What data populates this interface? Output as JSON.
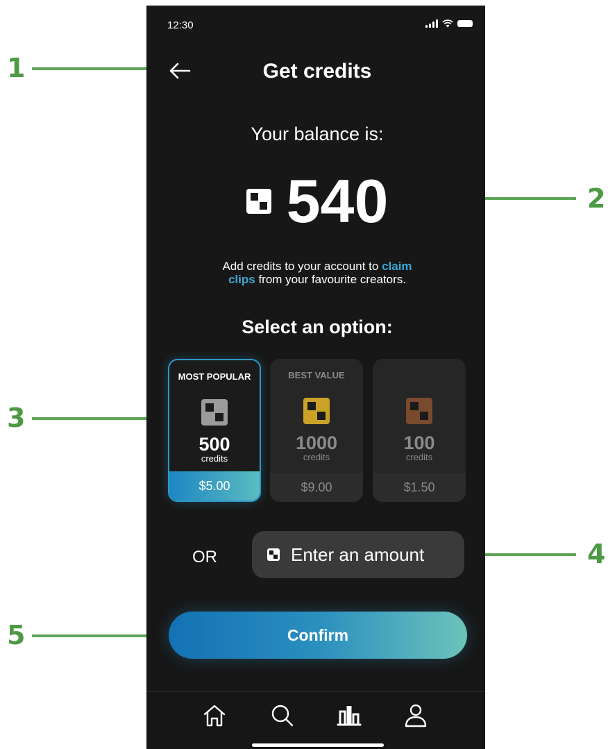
{
  "status_bar": {
    "time": "12:30"
  },
  "header": {
    "title": "Get credits"
  },
  "balance": {
    "label": "Your balance is:",
    "value": "540"
  },
  "info": {
    "text_before": "Add credits to your account to ",
    "highlight_1": "claim",
    "highlight_2": "clips",
    "text_after": " from your favourite creators."
  },
  "options": {
    "heading": "Select an option:",
    "cards": [
      {
        "badge": "MOST POPULAR",
        "amount": "500",
        "unit": "credits",
        "price": "$5.00",
        "icon_color": "#9b9b9b",
        "selected": true
      },
      {
        "badge": "BEST VALUE",
        "amount": "1000",
        "unit": "credits",
        "price": "$9.00",
        "icon_color": "#c9a227",
        "selected": false
      },
      {
        "badge": "",
        "amount": "100",
        "unit": "credits",
        "price": "$1.50",
        "icon_color": "#7a4a2e",
        "selected": false
      }
    ]
  },
  "custom_amount": {
    "or_label": "OR",
    "placeholder": "Enter an amount"
  },
  "confirm": {
    "label": "Confirm"
  },
  "nav": {
    "items": [
      "home-icon",
      "search-icon",
      "stats-icon",
      "profile-icon"
    ]
  },
  "callouts": [
    "1",
    "2",
    "3",
    "4",
    "5"
  ],
  "colors": {
    "accent": "#2f97c7",
    "callout": "#4d9a45",
    "background": "#171717"
  }
}
